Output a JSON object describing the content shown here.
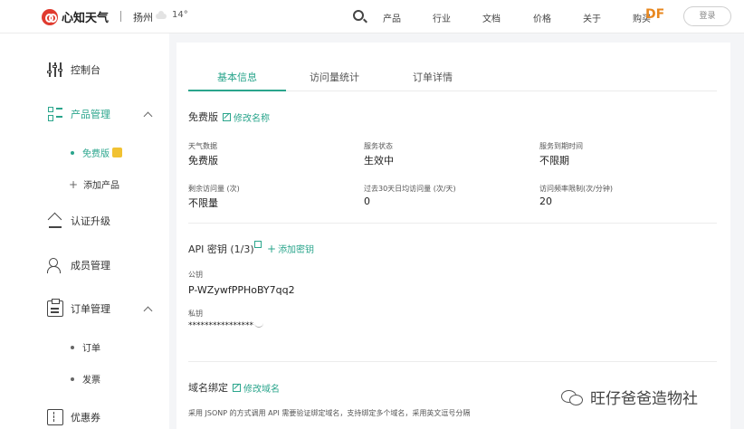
{
  "header": {
    "brand": "心知天气",
    "city": "扬州",
    "temperature": "14°",
    "nav": [
      "产品",
      "行业",
      "文档",
      "价格",
      "关于"
    ],
    "partial_nav": "购买",
    "corner_mark": "DF",
    "login_label": "登录"
  },
  "sidebar": {
    "dashboard": "控制台",
    "product_mgmt": "产品管理",
    "free_plan": "免费版",
    "add_product": "添加产品",
    "auth_upgrade": "认证升级",
    "member_mgmt": "成员管理",
    "order_mgmt": "订单管理",
    "orders": "订单",
    "invoices": "发票",
    "coupons": "优惠券"
  },
  "tabs": [
    "基本信息",
    "访问量统计",
    "订单详情"
  ],
  "plan": {
    "title": "免费版",
    "rename_link": "修改名称",
    "fields": [
      {
        "label": "天气数据",
        "value": "免费版"
      },
      {
        "label": "服务状态",
        "value": "生效中"
      },
      {
        "label": "服务到期时间",
        "value": "不限期"
      },
      {
        "label": "剩余访问量 (次)",
        "value": "不限量"
      },
      {
        "label": "过去30天日均访问量 (次/天)",
        "value": "0"
      },
      {
        "label": "访问频率限制(次/分钟)",
        "value": "20"
      }
    ]
  },
  "api": {
    "title": "API 密钥 (1/3)",
    "add_link": "添加密钥",
    "public_label": "公钥",
    "public_value": "P-WZywfPPHoBY7qq2",
    "private_label": "私钥",
    "private_value": "****************"
  },
  "domain": {
    "title": "域名绑定",
    "edit_link": "修改域名",
    "note": "采用 JSONP 的方式调用 API 需要验证绑定域名，支持绑定多个域名，采用英文逗号分隔"
  },
  "watermark": "旺仔爸爸造物社",
  "colors": {
    "accent": "#2aa58c",
    "brand_red": "#e03b2f"
  }
}
